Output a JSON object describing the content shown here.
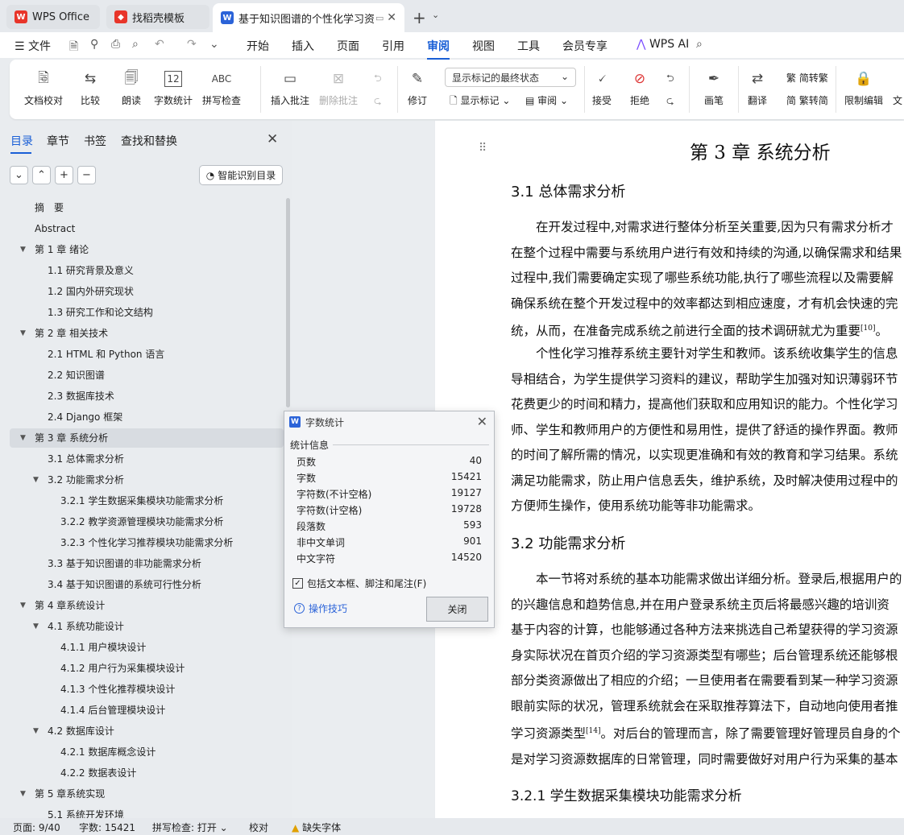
{
  "tabs": [
    {
      "label": "WPS Office",
      "icon": "wps-logo-icon"
    },
    {
      "label": "找稻壳模板",
      "icon": "docer-logo-icon"
    },
    {
      "label": "基于知识图谱的个性化学习资",
      "icon": "writer-logo-icon"
    }
  ],
  "menu": {
    "file": "文件",
    "items": [
      "开始",
      "插入",
      "页面",
      "引用",
      "审阅",
      "视图",
      "工具",
      "会员专享"
    ],
    "active": "审阅",
    "ai": "WPS AI"
  },
  "ribbon": {
    "doc_check": "文档校对",
    "compare": "比较",
    "read_aloud": "朗读",
    "word_count": "字数统计",
    "spell_check": "拼写检查",
    "insert_comment": "插入批注",
    "delete_comment": "删除批注",
    "revise": "修订",
    "markup_select": "显示标记的最终状态",
    "show_markup": "显示标记",
    "review": "审阅",
    "accept": "接受",
    "reject": "拒绝",
    "pen": "画笔",
    "translate": "翻译",
    "to_traditional": "简转繁",
    "to_simplified": "繁转简",
    "restrict": "限制编辑",
    "more": "文"
  },
  "panel": {
    "tabs": [
      "目录",
      "章节",
      "书签",
      "查找和替换"
    ],
    "smart_btn": "智能识别目录",
    "toc": [
      {
        "label": "摘　要",
        "level": 1,
        "arrow": ""
      },
      {
        "label": "Abstract",
        "level": 1,
        "arrow": ""
      },
      {
        "label": "第 1 章  绪论",
        "level": 1,
        "arrow": "down"
      },
      {
        "label": "1.1 研究背景及意义",
        "level": 2,
        "arrow": ""
      },
      {
        "label": "1.2  国内外研究现状",
        "level": 2,
        "arrow": ""
      },
      {
        "label": "1.3  研究工作和论文结构",
        "level": 2,
        "arrow": ""
      },
      {
        "label": "第 2 章  相关技术",
        "level": 1,
        "arrow": "down"
      },
      {
        "label": "2.1 HTML 和 Python 语言",
        "level": 2,
        "arrow": ""
      },
      {
        "label": "2.2  知识图谱",
        "level": 2,
        "arrow": ""
      },
      {
        "label": "2.3  数据库技术",
        "level": 2,
        "arrow": ""
      },
      {
        "label": "2.4 Django  框架",
        "level": 2,
        "arrow": ""
      },
      {
        "label": "第 3 章  系统分析",
        "level": 1,
        "arrow": "down",
        "selected": true
      },
      {
        "label": "3.1  总体需求分析",
        "level": 2,
        "arrow": ""
      },
      {
        "label": "3.2  功能需求分析",
        "level": 2,
        "arrow": "down"
      },
      {
        "label": "3.2.1 学生数据采集模块功能需求分析",
        "level": 3,
        "arrow": ""
      },
      {
        "label": "3.2.2 教学资源管理模块功能需求分析",
        "level": 3,
        "arrow": ""
      },
      {
        "label": "3.2.3 个性化学习推荐模块功能需求分析",
        "level": 3,
        "arrow": ""
      },
      {
        "label": "3.3  基于知识图谱的非功能需求分析",
        "level": 2,
        "arrow": ""
      },
      {
        "label": "3.4  基于知识图谱的系统可行性分析",
        "level": 2,
        "arrow": ""
      },
      {
        "label": "第 4 章系统设计",
        "level": 1,
        "arrow": "down"
      },
      {
        "label": "4.1  系统功能设计",
        "level": 2,
        "arrow": "down"
      },
      {
        "label": "4.1.1  用户模块设计",
        "level": 3,
        "arrow": ""
      },
      {
        "label": "4.1.2  用户行为采集模块设计",
        "level": 3,
        "arrow": ""
      },
      {
        "label": "4.1.3  个性化推荐模块设计",
        "level": 3,
        "arrow": ""
      },
      {
        "label": "4.1.4  后台管理模块设计",
        "level": 3,
        "arrow": ""
      },
      {
        "label": "4.2  数据库设计",
        "level": 2,
        "arrow": "down"
      },
      {
        "label": "4.2.1  数据库概念设计",
        "level": 3,
        "arrow": ""
      },
      {
        "label": "4.2.2  数据表设计",
        "level": 3,
        "arrow": ""
      },
      {
        "label": "第 5 章系统实现",
        "level": 1,
        "arrow": "down"
      },
      {
        "label": "5.1  系统开发环境",
        "level": 2,
        "arrow": ""
      }
    ]
  },
  "doc": {
    "h1": "第 3 章  系统分析",
    "h2_1": "3.1  总体需求分析",
    "p1": [
      "　　在开发过程中,对需求进行整体分析至关重要,因为只有需求分析才",
      "在整个过程中需要与系统用户进行有效和持续的沟通,以确保需求和结果",
      "过程中,我们需要确定实现了哪些系统功能,执行了哪些流程以及需要解",
      "确保系统在整个开发过程中的效率都达到相应速度，才有机会快速的完",
      "统，从而，在准备完成系统之前进行全面的技术调研就尤为重要"
    ],
    "p1_ref": "[10]",
    "p1_end": "。",
    "p2": [
      "　　个性化学习推荐系统主要针对学生和教师。该系统收集学生的信息",
      "导相结合，为学生提供学习资料的建议，帮助学生加强对知识薄弱环节",
      "花费更少的时间和精力，提高他们获取和应用知识的能力。个性化学习",
      "师、学生和教师用户的方便性和易用性，提供了舒适的操作界面。教师",
      "的时间了解所需的情况，以实现更准确和有效的教育和学习结果。系统",
      "满足功能需求，防止用户信息丢失，维护系统，及时解决使用过程中的",
      "方便师生操作，使用系统功能等非功能需求。"
    ],
    "h2_2": "3.2  功能需求分析",
    "p3": [
      "　　本一节将对系统的基本功能需求做出详细分析。登录后,根据用户的",
      "的兴趣信息和趋势信息,并在用户登录系统主页后将最感兴趣的培训资",
      "基于内容的计算，也能够通过各种方法来挑选自己希望获得的学习资源",
      "身实际状况在首页介绍的学习资源类型有哪些；后台管理系统还能够根",
      "部分类资源做出了相应的介绍；一旦使用者在需要看到某一种学习资源",
      "眼前实际的状况，管理系统就会在采取推荐算法下，自动地向使用者推"
    ],
    "p3_l7": "学习资源类型",
    "p3_ref": "[14]",
    "p3_l7b": "。对后台的管理而言，除了需要管理好管理员自身的个",
    "p3_l8": "是对学习资源数据库的日常管理，同时需要做好对用户行为采集的基本",
    "h3": "3.2.1 学生数据采集模块功能需求分析"
  },
  "dialog": {
    "title": "字数统计",
    "section": "统计信息",
    "stats": [
      {
        "label": "页数",
        "value": "40"
      },
      {
        "label": "字数",
        "value": "15421"
      },
      {
        "label": "字符数(不计空格)",
        "value": "19127"
      },
      {
        "label": "字符数(计空格)",
        "value": "19728"
      },
      {
        "label": "段落数",
        "value": "593"
      },
      {
        "label": "非中文单词",
        "value": "901"
      },
      {
        "label": "中文字符",
        "value": "14520"
      }
    ],
    "checkbox": "包括文本框、脚注和尾注(F)",
    "checked": true,
    "tips": "操作技巧",
    "close": "关闭"
  },
  "status": {
    "page": "页面: 9/40",
    "words": "字数: 15421",
    "spell": "拼写检查: 打开",
    "proof": "校对",
    "missing_font": "缺失字体"
  },
  "colors": {
    "accent": "#1a5fd6",
    "wps_red": "#e8352a",
    "panel_bg": "#e9ecef"
  }
}
